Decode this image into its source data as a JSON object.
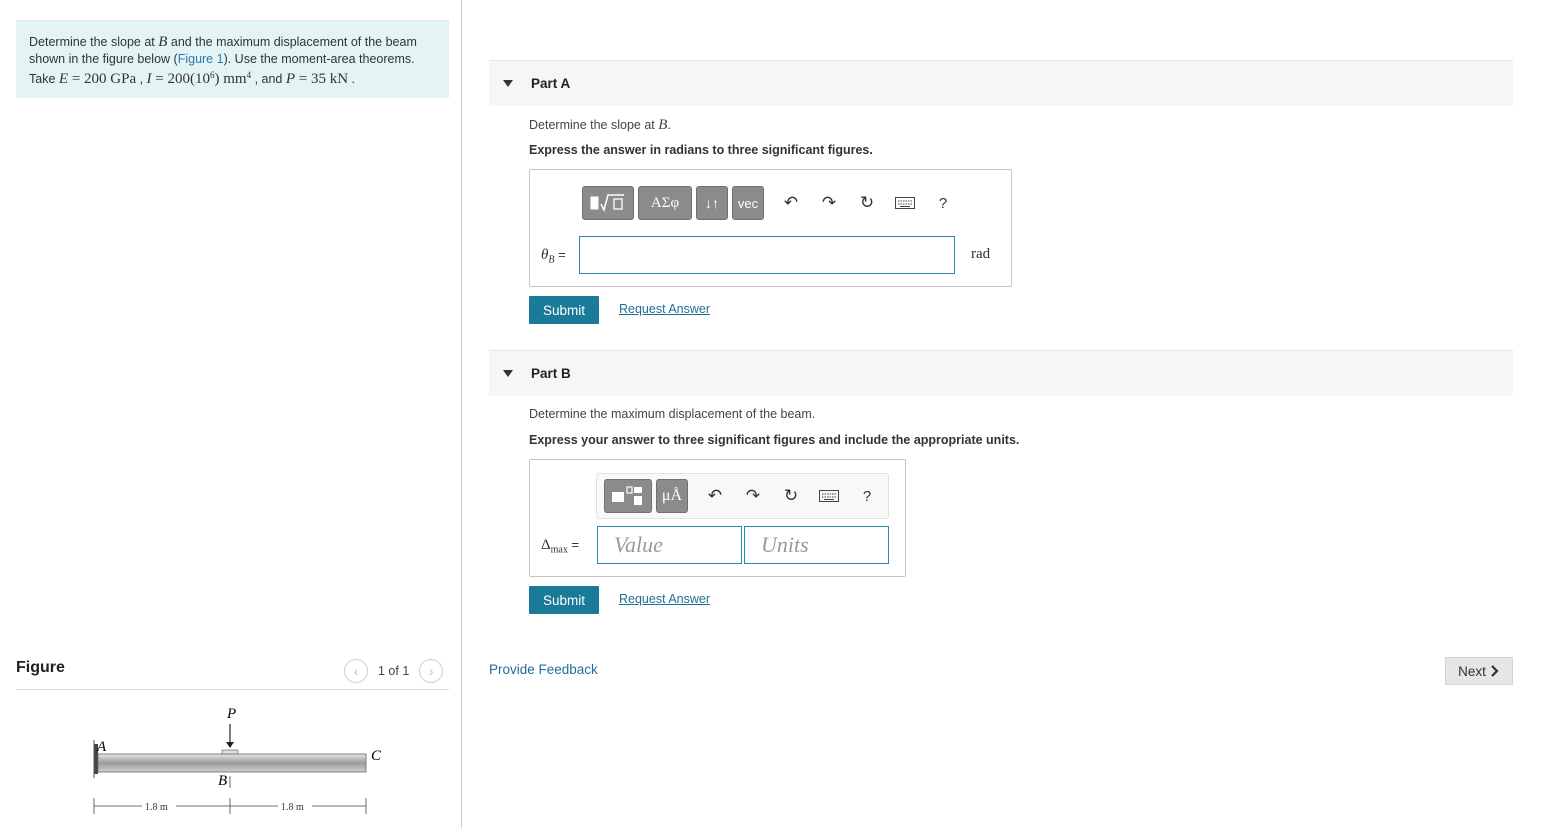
{
  "problem": {
    "line1_a": "Determine the slope at ",
    "line1_var": "B",
    "line1_b": " and the maximum displacement of the beam",
    "line2_a": "shown in the figure below (",
    "line2_link": "Figure 1",
    "line2_b": "). Use the moment-area theorems.",
    "line3_take": "Take ",
    "line3_E": "E",
    "line3_Eval": " = 200 GPa",
    "line3_sep1": " , ",
    "line3_I": "I",
    "line3_Ival": " = 200(10",
    "line3_Iexp": "6",
    "line3_Iunit": ") mm",
    "line3_Iunitexp": "4",
    "line3_and": " , and ",
    "line3_P": "P",
    "line3_Pval": " = 35 kN",
    "line3_end": " ."
  },
  "figure": {
    "title": "Figure",
    "prev_icon": "chevron-left-icon",
    "next_icon": "chevron-right-icon",
    "count": "1 of 1",
    "labels": {
      "P": "P",
      "A": "A",
      "B": "B",
      "C": "C",
      "dim1": "1.8 m",
      "dim2": "1.8 m"
    }
  },
  "partA": {
    "label": "Part A",
    "question_a": "Determine the slope at ",
    "question_var": "B",
    "question_b": ".",
    "instruction": "Express the answer in radians to three significant figures.",
    "toolbar": {
      "template_icon": "template-icon",
      "greek": "ΑΣφ",
      "arrows": "↓↑",
      "vec": "vec",
      "undo_icon": "undo-icon",
      "redo_icon": "redo-icon",
      "reset_icon": "reset-icon",
      "keyboard_icon": "keyboard-icon",
      "help": "?"
    },
    "var_theta": "θ",
    "var_sub": "B",
    "equals": " =",
    "input_value": "",
    "unit": "rad",
    "submit": "Submit",
    "request": "Request Answer"
  },
  "partB": {
    "label": "Part B",
    "question": "Determine the maximum displacement of the beam.",
    "instruction": "Express your answer to three significant figures and include the appropriate units.",
    "toolbar": {
      "template_icon": "value-units-template-icon",
      "units_glyph": "μÅ",
      "undo_icon": "undo-icon",
      "redo_icon": "redo-icon",
      "reset_icon": "reset-icon",
      "keyboard_icon": "keyboard-icon",
      "help": "?"
    },
    "var_delta": "Δ",
    "var_sub": "max",
    "equals": " =",
    "value_placeholder": "Value",
    "units_placeholder": "Units",
    "submit": "Submit",
    "request": "Request Answer"
  },
  "footer": {
    "feedback": "Provide Feedback",
    "next": "Next"
  },
  "colors": {
    "accent": "#1a7a9a",
    "link": "#1e6f98",
    "problem_bg": "#e4f4f5"
  }
}
